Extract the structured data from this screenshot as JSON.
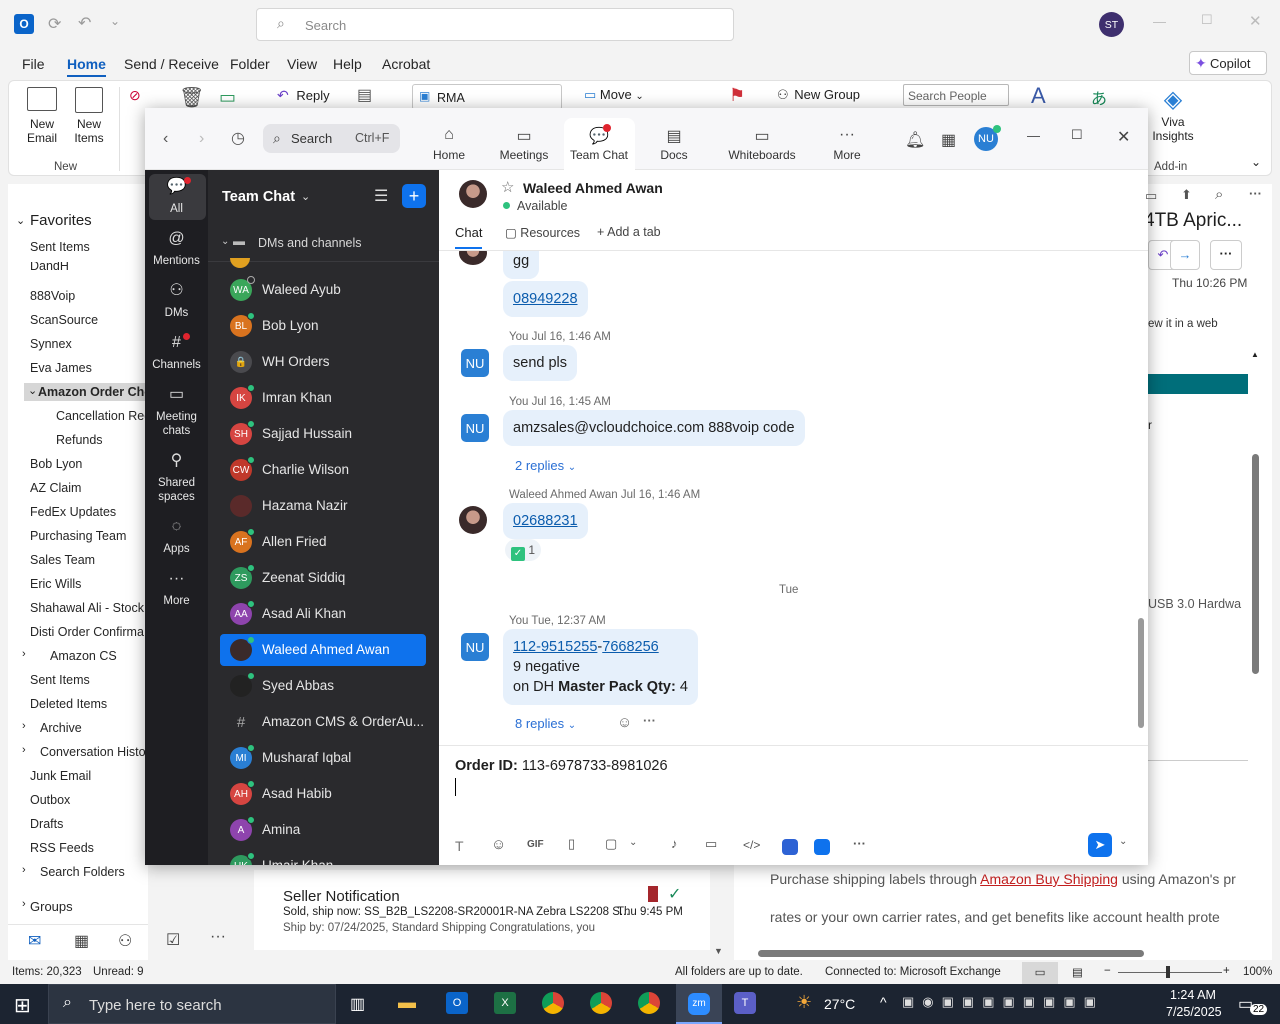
{
  "outlook": {
    "search_placeholder": "Search",
    "user_initials": "ST",
    "menu": [
      "File",
      "Home",
      "Send / Receive",
      "Folder",
      "View",
      "Help",
      "Acrobat"
    ],
    "copilot": "Copilot",
    "ribbon": {
      "new_email": "New Email",
      "new_items": "New Items",
      "group_new": "New",
      "reply": "Reply",
      "rma": "RMA",
      "move": "Move",
      "new_group": "New Group",
      "search_people": "Search People",
      "viva": "Viva Insights",
      "addin": "Add-in"
    },
    "favorites": "Favorites",
    "folders": [
      "Sent Items",
      "DandH",
      "888Voip",
      "ScanSource",
      "Synnex",
      "Eva James",
      "Amazon Order Cho",
      "Cancellation Requ",
      "Refunds",
      "Bob Lyon",
      "AZ Claim",
      "FedEx Updates",
      "Purchasing Team",
      "Sales Team",
      "Eric Wills",
      "Shahawal Ali - Stock",
      "Disti Order Confirma",
      "Amazon CS",
      "Sent Items",
      "Deleted Items",
      "Archive",
      "Conversation History",
      "Junk Email",
      "Outbox",
      "Drafts",
      "RSS Feeds",
      "Search Folders",
      "Groups"
    ],
    "reading": {
      "title_frag": "4TB Apric...",
      "time": "Thu 10:26 PM",
      "view_web": "ew it in a web",
      "r_frag": "r",
      "usb": "USB 3.0 Hardwa",
      "body1": "Purchase shipping labels through",
      "body_link": "Amazon Buy Shipping",
      "body2": "using Amazon's pr",
      "body3": "rates or your own carrier rates, and get benefits like account health prote",
      "body4": "protection on late deliveries, and more."
    },
    "msg": {
      "sender": "Seller Notification",
      "subject": "Sold, ship now: SS_B2B_LS2208-SR20001R-NA Zebra LS2208 S...",
      "time": "Thu 9:45 PM",
      "preview": "Ship by: 07/24/2025, Standard Shipping  Congratulations, you"
    },
    "status": {
      "items": "Items: 20,323",
      "unread": "Unread: 9",
      "sync": "All folders are up to date.",
      "conn": "Connected to: Microsoft Exchange",
      "zoom": "100%"
    }
  },
  "taskbar": {
    "search": "Type here to search",
    "weather": "27°C",
    "time": "1:24 AM",
    "date": "7/25/2025",
    "notif": "22"
  },
  "zoom": {
    "search": "Search",
    "shortcut": "Ctrl+F",
    "tabs": [
      "Home",
      "Meetings",
      "Team Chat",
      "Docs",
      "Whiteboards",
      "More"
    ],
    "me": "NU",
    "rail": [
      "All",
      "Mentions",
      "DMs",
      "Channels",
      "Meeting chats",
      "Shared spaces",
      "Apps",
      "More"
    ],
    "list_title": "Team Chat",
    "section": "DMs and channels",
    "contacts": [
      {
        "n": "Waleed Ayub",
        "i": "WA",
        "c": "#3aa65a"
      },
      {
        "n": "Bob Lyon",
        "i": "BL",
        "c": "#d9731f"
      },
      {
        "n": "WH Orders",
        "i": "🔒",
        "c": "#4a4a4e"
      },
      {
        "n": "Imran Khan",
        "i": "IK",
        "c": "#d64541"
      },
      {
        "n": "Sajjad Hussain",
        "i": "SH",
        "c": "#d64541"
      },
      {
        "n": "Charlie Wilson",
        "i": "CW",
        "c": "#c0392b"
      },
      {
        "n": "Hazama Nazir",
        "i": "",
        "c": "#5a2a2a"
      },
      {
        "n": "Allen Fried",
        "i": "AF",
        "c": "#d9731f"
      },
      {
        "n": "Zeenat Siddiq",
        "i": "ZS",
        "c": "#2e9a5e"
      },
      {
        "n": "Asad Ali Khan",
        "i": "AA",
        "c": "#8e44ad"
      },
      {
        "n": "Waleed Ahmed Awan",
        "i": "",
        "c": "#3a2a2a"
      },
      {
        "n": "Syed Abbas",
        "i": "",
        "c": "#222"
      },
      {
        "n": "Amazon CMS & OrderAu...",
        "i": "#",
        "c": "#3a3a3e"
      },
      {
        "n": "Musharaf Iqbal",
        "i": "MI",
        "c": "#2a7fd4"
      },
      {
        "n": "Asad Habib",
        "i": "AH",
        "c": "#d64541"
      },
      {
        "n": "Amina",
        "i": "A",
        "c": "#8e44ad"
      },
      {
        "n": "Umair Khan",
        "i": "UK",
        "c": "#2e9a5e"
      }
    ],
    "chat": {
      "name": "Waleed Ahmed Awan",
      "status": "Available",
      "tabs": [
        "Chat",
        "Resources",
        "Add a tab"
      ],
      "m0": "gg",
      "m1": "08949228",
      "m2_meta": "You Jul 16, 1:46 AM",
      "m2": "send pls",
      "m3_meta": "You Jul 16, 1:45 AM",
      "m3": "amzsales@vcloudchoice.com 888voip code",
      "m3_rep": "2 replies",
      "m4_meta": "Waleed Ahmed Awan Jul 16, 1:46 AM",
      "m4": "02688231",
      "m4_react": "1",
      "day": "Tue",
      "m5_meta": "You Tue, 12:37 AM",
      "m5a": "112-9515255",
      "m5b": "7668256",
      "m5_l2": "9 negative",
      "m5_l3a": "on DH ",
      "m5_l3b": "Master Pack Qty:",
      "m5_l3c": " 4",
      "m5_rep": "8 replies",
      "compose_label": "Order ID:",
      "compose_value": " 113-6978733-8981026"
    }
  }
}
